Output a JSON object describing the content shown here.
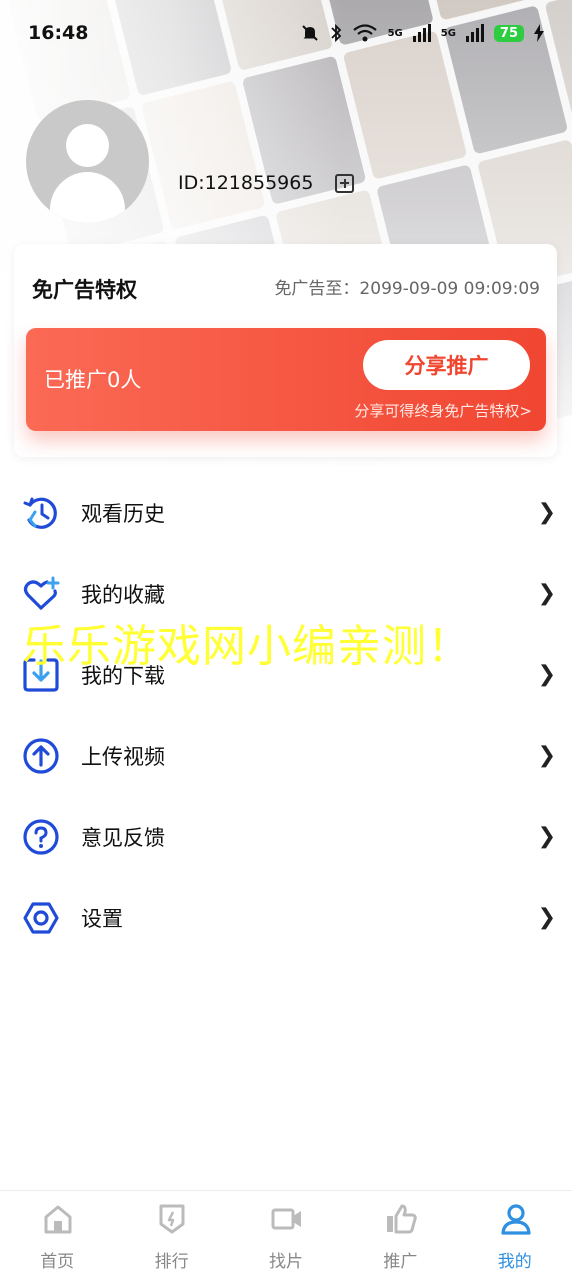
{
  "status_bar": {
    "time": "16:48",
    "battery": "75",
    "signal1": "5G",
    "signal2": "5G"
  },
  "profile": {
    "id_text": "ID:121855965"
  },
  "privilege": {
    "title": "免广告特权",
    "expiry": "免广告至：2099-09-09 09:09:09",
    "promoted": "已推广0人",
    "share_button": "分享推广",
    "hint": "分享可得终身免广告特权>"
  },
  "menu": [
    {
      "label": "观看历史",
      "icon": "history-icon"
    },
    {
      "label": "我的收藏",
      "icon": "heart-plus-icon"
    },
    {
      "label": "我的下载",
      "icon": "download-icon"
    },
    {
      "label": "上传视频",
      "icon": "upload-icon"
    },
    {
      "label": "意见反馈",
      "icon": "question-icon"
    },
    {
      "label": "设置",
      "icon": "settings-icon"
    }
  ],
  "watermark": "乐乐游戏网小编亲测！",
  "tabs": [
    {
      "label": "首页",
      "icon": "home-icon"
    },
    {
      "label": "排行",
      "icon": "ranking-icon"
    },
    {
      "label": "找片",
      "icon": "video-camera-icon"
    },
    {
      "label": "推广",
      "icon": "thumbs-up-icon"
    },
    {
      "label": "我的",
      "icon": "user-icon",
      "active": true
    }
  ],
  "colors": {
    "accent": "#2f8fe0",
    "icon_blue": "#1f4bd8",
    "promo_red": "#f04632"
  }
}
